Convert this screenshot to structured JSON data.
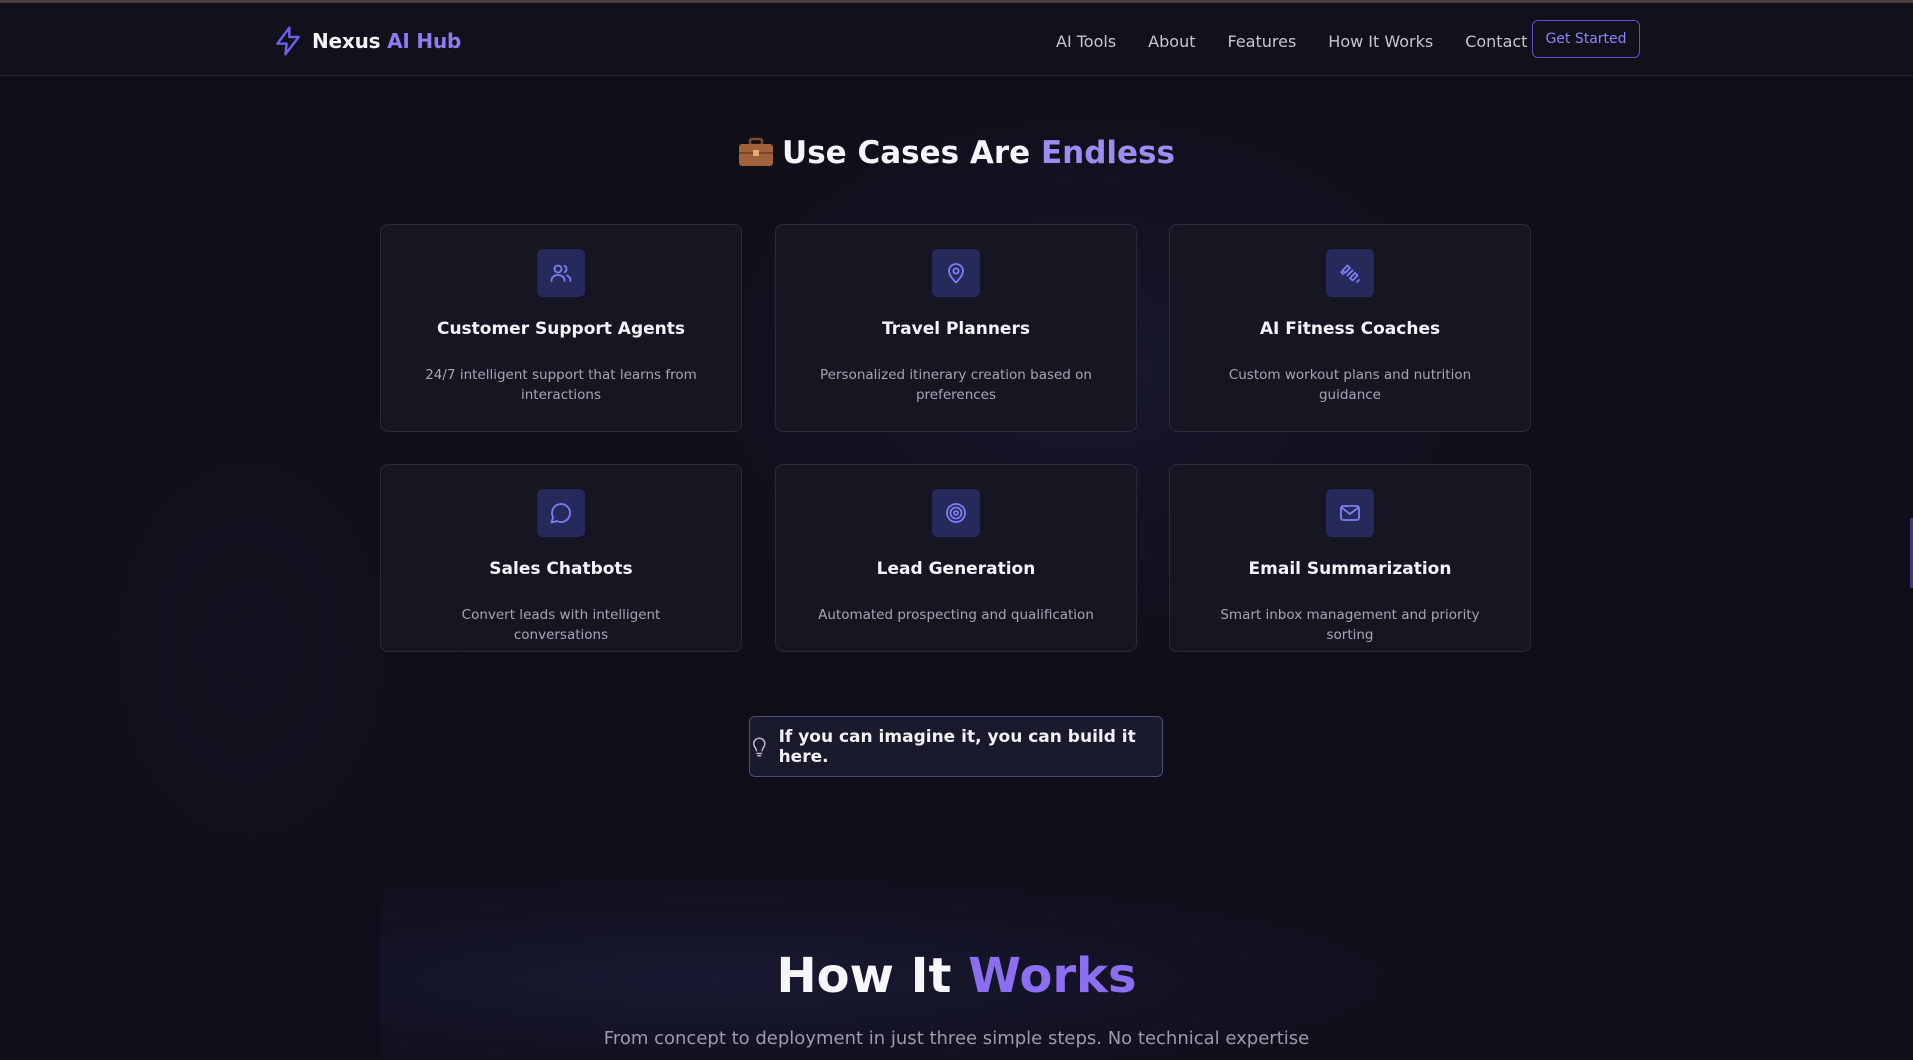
{
  "brand": {
    "name_first": "Nexus",
    "name_second": "AI Hub",
    "icon": "lightning-bolt-icon"
  },
  "nav": {
    "links": [
      "AI Tools",
      "About",
      "Features",
      "How It Works",
      "Contact"
    ],
    "cta_label": "Get Started"
  },
  "use_cases": {
    "emoji_icon": "briefcase-icon",
    "title_prefix": "Use Cases Are",
    "title_highlight": "Endless",
    "cards": [
      {
        "icon": "users-icon",
        "title": "Customer Support Agents",
        "description": "24/7 intelligent support that learns from interactions"
      },
      {
        "icon": "map-pin-icon",
        "title": "Travel Planners",
        "description": "Personalized itinerary creation based on preferences"
      },
      {
        "icon": "dumbbell-icon",
        "title": "AI Fitness Coaches",
        "description": "Custom workout plans and nutrition guidance"
      },
      {
        "icon": "chat-bubble-icon",
        "title": "Sales Chatbots",
        "description": "Convert leads with intelligent conversations"
      },
      {
        "icon": "target-icon",
        "title": "Lead Generation",
        "description": "Automated prospecting and qualification"
      },
      {
        "icon": "mail-icon",
        "title": "Email Summarization",
        "description": "Smart inbox management and priority sorting"
      }
    ],
    "tip": {
      "icon": "lightbulb-icon",
      "text": "If you can imagine it, you can build it here."
    }
  },
  "how_it_works": {
    "title_prefix": "How It",
    "title_highlight": "Works",
    "subtitle": "From concept to deployment in just three simple steps. No technical expertise"
  },
  "colors": {
    "accent": "#8b7cf0",
    "accent_button": "#8b84ff",
    "icon": "#7b7ff5",
    "background": "#0f0e19",
    "card": "#161623"
  }
}
